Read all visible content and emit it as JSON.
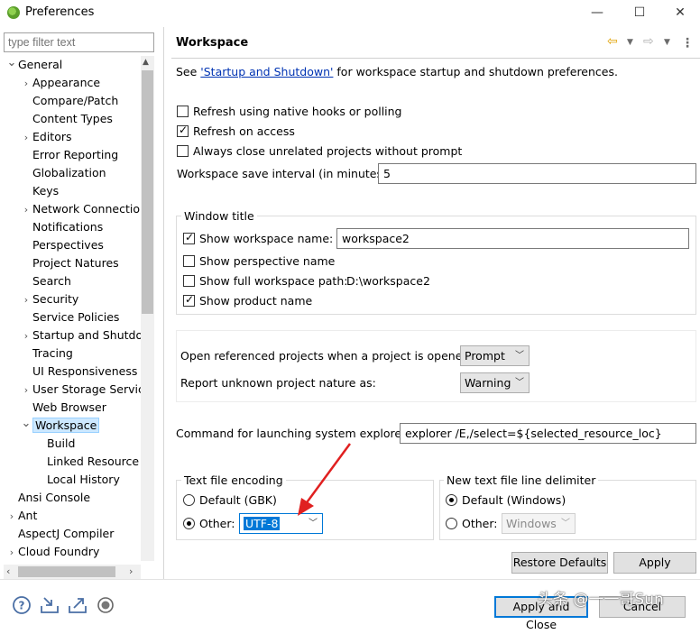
{
  "window": {
    "title": "Preferences",
    "controls": {
      "minimize": "—",
      "maximize": "☐",
      "close": "✕"
    }
  },
  "left": {
    "filter_placeholder": "type filter text",
    "tree": [
      {
        "label": "General",
        "level": 0,
        "expander": "expanded"
      },
      {
        "label": "Appearance",
        "level": 1,
        "expander": "collapsed"
      },
      {
        "label": "Compare/Patch",
        "level": 1,
        "expander": "none"
      },
      {
        "label": "Content Types",
        "level": 1,
        "expander": "none"
      },
      {
        "label": "Editors",
        "level": 1,
        "expander": "collapsed"
      },
      {
        "label": "Error Reporting",
        "level": 1,
        "expander": "none"
      },
      {
        "label": "Globalization",
        "level": 1,
        "expander": "none"
      },
      {
        "label": "Keys",
        "level": 1,
        "expander": "none"
      },
      {
        "label": "Network Connectio",
        "level": 1,
        "expander": "collapsed"
      },
      {
        "label": "Notifications",
        "level": 1,
        "expander": "none"
      },
      {
        "label": "Perspectives",
        "level": 1,
        "expander": "none"
      },
      {
        "label": "Project Natures",
        "level": 1,
        "expander": "none"
      },
      {
        "label": "Search",
        "level": 1,
        "expander": "none"
      },
      {
        "label": "Security",
        "level": 1,
        "expander": "collapsed"
      },
      {
        "label": "Service Policies",
        "level": 1,
        "expander": "none"
      },
      {
        "label": "Startup and Shutdo",
        "level": 1,
        "expander": "collapsed"
      },
      {
        "label": "Tracing",
        "level": 1,
        "expander": "none"
      },
      {
        "label": "UI Responsiveness",
        "level": 1,
        "expander": "none"
      },
      {
        "label": "User Storage Servic",
        "level": 1,
        "expander": "collapsed"
      },
      {
        "label": "Web Browser",
        "level": 1,
        "expander": "none"
      },
      {
        "label": "Workspace",
        "level": 1,
        "expander": "expanded",
        "selected": true
      },
      {
        "label": "Build",
        "level": 2,
        "expander": "none"
      },
      {
        "label": "Linked Resource",
        "level": 2,
        "expander": "none"
      },
      {
        "label": "Local History",
        "level": 2,
        "expander": "none"
      },
      {
        "label": "Ansi Console",
        "level": 0,
        "expander": "none"
      },
      {
        "label": "Ant",
        "level": 0,
        "expander": "collapsed"
      },
      {
        "label": "AspectJ Compiler",
        "level": 0,
        "expander": "none"
      },
      {
        "label": "Cloud Foundry",
        "level": 0,
        "expander": "collapsed"
      }
    ]
  },
  "page": {
    "title": "Workspace",
    "intro_prefix": "See ",
    "intro_link": "'Startup and Shutdown'",
    "intro_suffix": " for workspace startup and shutdown preferences.",
    "refresh_native": {
      "label": "Refresh using native hooks or polling",
      "checked": false
    },
    "refresh_access": {
      "label": "Refresh on access",
      "checked": true
    },
    "close_unrelated": {
      "label": "Always close unrelated projects without prompt",
      "checked": false
    },
    "save_interval": {
      "label": "Workspace save interval (in minutes):",
      "value": "5"
    },
    "window_title": {
      "group_label": "Window title",
      "show_ws_name": {
        "label": "Show workspace name:",
        "checked": true,
        "value": "workspace2"
      },
      "show_perspective": {
        "label": "Show perspective name",
        "checked": false
      },
      "show_full_path": {
        "label": "Show full workspace path:",
        "checked": false,
        "value": "D:\\workspace2"
      },
      "show_product": {
        "label": "Show product name",
        "checked": true
      }
    },
    "open_ref": {
      "label": "Open referenced projects when a project is opened:",
      "value": "Prompt"
    },
    "unknown_nature": {
      "label": "Report unknown project nature as:",
      "value": "Warning"
    },
    "explorer_cmd": {
      "label": "Command for launching system explorer:",
      "value": "explorer /E,/select=${selected_resource_loc}"
    },
    "encoding": {
      "group_label": "Text file encoding",
      "default_label": "Default (GBK)",
      "default_selected": false,
      "other_label": "Other:",
      "other_selected": true,
      "other_value": "UTF-8"
    },
    "line_delim": {
      "group_label": "New text file line delimiter",
      "default_label": "Default (Windows)",
      "default_selected": true,
      "other_label": "Other:",
      "other_selected": false,
      "other_value": "Windows"
    },
    "restore_defaults": "Restore Defaults",
    "apply": "Apply"
  },
  "footer": {
    "apply_close": "Apply and Close",
    "cancel": "Cancel",
    "icons": [
      "help-icon",
      "import-icon",
      "export-icon",
      "record-icon"
    ]
  },
  "watermark": "头条 @一一哥Sun",
  "colors": {
    "selection": "#cce8ff",
    "link": "#0033b3",
    "focus": "#0078d7",
    "annotation_arrow": "#e02020"
  }
}
